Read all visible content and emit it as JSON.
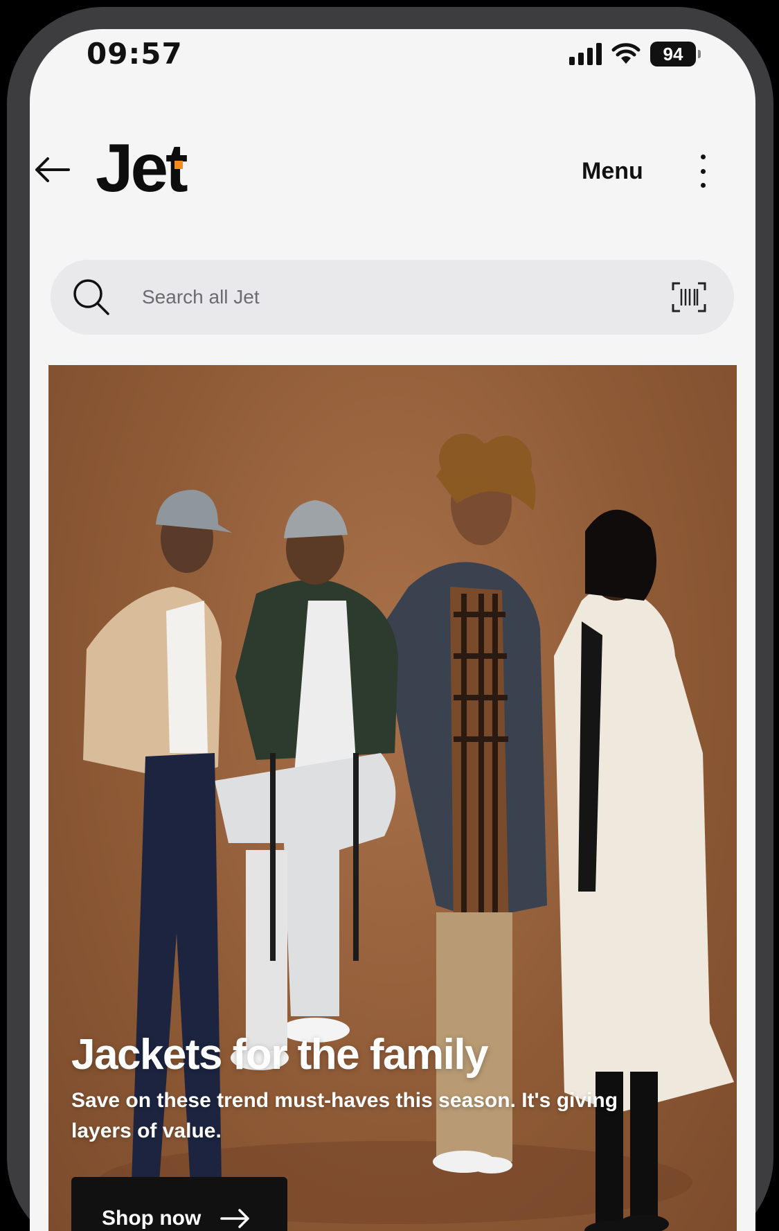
{
  "status_bar": {
    "time": "09:57",
    "battery": "94"
  },
  "header": {
    "logo_text": "Jet",
    "menu_label": "Menu"
  },
  "search": {
    "placeholder": "Search all Jet"
  },
  "hero": {
    "title": "Jackets for the family",
    "subtitle": "Save on these trend must-haves this season. It's giving layers of value.",
    "cta_label": "Shop now"
  },
  "icons": {
    "back": "arrow-left-icon",
    "search": "search-icon",
    "barcode": "barcode-scan-icon",
    "more": "kebab-menu-icon",
    "cta": "arrow-right-icon"
  },
  "colors": {
    "brand_accent": "#f28c1c",
    "hero_background": "#8e5a36",
    "cta_background": "#111111",
    "search_background": "#e9e9ec"
  }
}
